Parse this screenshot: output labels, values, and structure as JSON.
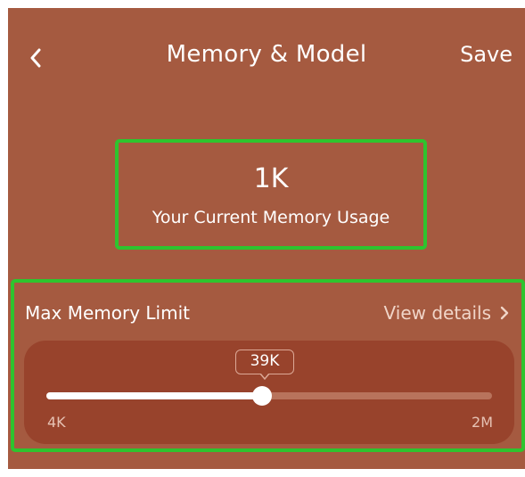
{
  "header": {
    "back_icon": "chevron-left-icon",
    "title": "Memory & Model",
    "save_label": "Save"
  },
  "usage": {
    "value": "1K",
    "caption": "Your Current Memory Usage"
  },
  "limit": {
    "title": "Max Memory Limit",
    "details_label": "View details",
    "details_icon": "chevron-right-icon",
    "slider": {
      "current_label": "39K",
      "min_label": "4K",
      "max_label": "2M",
      "position_fraction": 0.483
    }
  },
  "colors": {
    "background": "#a55a40",
    "slider_card": "#98432c",
    "highlight_outline": "#2ec42e"
  }
}
